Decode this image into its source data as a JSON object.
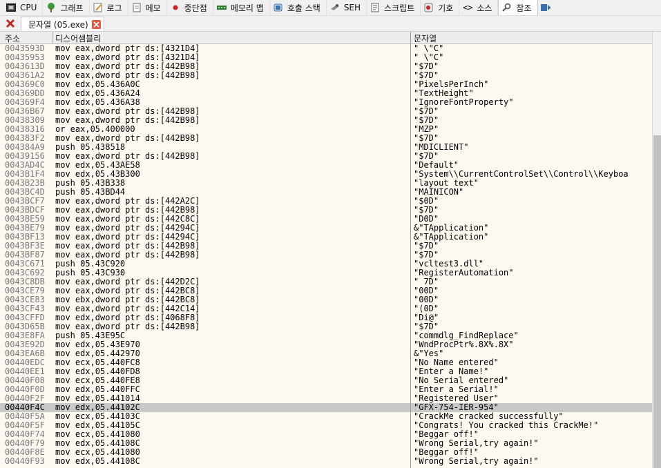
{
  "toolbar": {
    "tabs": [
      {
        "label": "CPU",
        "icon": "cpu-icon"
      },
      {
        "label": "그래프",
        "icon": "graph-icon"
      },
      {
        "label": "로그",
        "icon": "log-icon"
      },
      {
        "label": "메모",
        "icon": "notes-icon"
      },
      {
        "label": "중단점",
        "icon": "breakpoint-icon"
      },
      {
        "label": "메모리 맵",
        "icon": "memory-map-icon"
      },
      {
        "label": "호출 스택",
        "icon": "call-stack-icon"
      },
      {
        "label": "SEH",
        "icon": "seh-icon"
      },
      {
        "label": "스크립트",
        "icon": "script-icon"
      },
      {
        "label": "기호",
        "icon": "symbols-icon"
      },
      {
        "label": "소스",
        "icon": "source-icon"
      },
      {
        "label": "참조",
        "icon": "references-icon"
      }
    ],
    "active": "참조"
  },
  "doc_tab": {
    "label": "문자열 (05.exe)"
  },
  "columns": {
    "address": "주소",
    "disassembly": "디스어셈블리",
    "string": "문자열"
  },
  "selected_index": 40,
  "rows": [
    {
      "addr": "0043593D",
      "dis": "mov eax,dword ptr ds:[4321D4]",
      "str": "\" \\\"C\""
    },
    {
      "addr": "00435953",
      "dis": "mov eax,dword ptr ds:[4321D4]",
      "str": "\" \\\"C\""
    },
    {
      "addr": "0043613D",
      "dis": "mov eax,dword ptr ds:[442B98]",
      "str": "\"$7D\""
    },
    {
      "addr": "004361A2",
      "dis": "mov eax,dword ptr ds:[442B98]",
      "str": "\"$7D\""
    },
    {
      "addr": "004369C0",
      "dis": "mov edx,05.436A0C",
      "str": "\"PixelsPerInch\""
    },
    {
      "addr": "004369DD",
      "dis": "mov edx,05.436A24",
      "str": "\"TextHeight\""
    },
    {
      "addr": "004369F4",
      "dis": "mov edx,05.436A38",
      "str": "\"IgnoreFontProperty\""
    },
    {
      "addr": "00436B67",
      "dis": "mov eax,dword ptr ds:[442B98]",
      "str": "\"$7D\""
    },
    {
      "addr": "00438309",
      "dis": "mov eax,dword ptr ds:[442B98]",
      "str": "\"$7D\""
    },
    {
      "addr": "00438316",
      "dis": "or eax,05.400000",
      "str": "\"MZP\""
    },
    {
      "addr": "004383F2",
      "dis": "mov eax,dword ptr ds:[442B98]",
      "str": "\"$7D\""
    },
    {
      "addr": "004384A9",
      "dis": "push 05.438518",
      "str": "\"MDICLIENT\""
    },
    {
      "addr": "00439156",
      "dis": "mov eax,dword ptr ds:[442B98]",
      "str": "\"$7D\""
    },
    {
      "addr": "0043AD4C",
      "dis": "mov edx,05.43AE58",
      "str": "\"Default\""
    },
    {
      "addr": "0043B1F4",
      "dis": "mov edx,05.43B300",
      "str": "\"System\\\\CurrentControlSet\\\\Control\\\\Keyboa"
    },
    {
      "addr": "0043B23B",
      "dis": "push 05.43B338",
      "str": "\"layout text\""
    },
    {
      "addr": "0043BC4D",
      "dis": "push 05.43BD44",
      "str": "\"MAINICON\""
    },
    {
      "addr": "0043BCF7",
      "dis": "mov eax,dword ptr ds:[442A2C]",
      "str": "\"$0D\""
    },
    {
      "addr": "0043BDCF",
      "dis": "mov eax,dword ptr ds:[442B98]",
      "str": "\"$7D\""
    },
    {
      "addr": "0043BE59",
      "dis": "mov eax,dword ptr ds:[442C8C]",
      "str": "\"D0D\""
    },
    {
      "addr": "0043BE79",
      "dis": "mov eax,dword ptr ds:[44294C]",
      "str": "&\"TApplication\""
    },
    {
      "addr": "0043BF13",
      "dis": "mov eax,dword ptr ds:[44294C]",
      "str": "&\"TApplication\""
    },
    {
      "addr": "0043BF3E",
      "dis": "mov eax,dword ptr ds:[442B98]",
      "str": "\"$7D\""
    },
    {
      "addr": "0043BF87",
      "dis": "mov eax,dword ptr ds:[442B98]",
      "str": "\"$7D\""
    },
    {
      "addr": "0043C671",
      "dis": "push 05.43C920",
      "str": "\"vcltest3.dll\""
    },
    {
      "addr": "0043C692",
      "dis": "push 05.43C930",
      "str": "\"RegisterAutomation\""
    },
    {
      "addr": "0043C8DB",
      "dis": "mov eax,dword ptr ds:[442D2C]",
      "str": "\" 7D\""
    },
    {
      "addr": "0043CE79",
      "dis": "mov eax,dword ptr ds:[442BC8]",
      "str": "\"00D\""
    },
    {
      "addr": "0043CE83",
      "dis": "mov ebx,dword ptr ds:[442BC8]",
      "str": "\"00D\""
    },
    {
      "addr": "0043CF43",
      "dis": "mov eax,dword ptr ds:[442C14]",
      "str": "\"(0D\""
    },
    {
      "addr": "0043CFFD",
      "dis": "mov edx,dword ptr ds:[4068F8]",
      "str": "\"Di@\""
    },
    {
      "addr": "0043D65B",
      "dis": "mov eax,dword ptr ds:[442B98]",
      "str": "\"$7D\""
    },
    {
      "addr": "0043E8FA",
      "dis": "push 05.43E95C",
      "str": "\"commdlg_FindReplace\""
    },
    {
      "addr": "0043E92D",
      "dis": "mov edx,05.43E970",
      "str": "\"WndProcPtr%.8X%.8X\""
    },
    {
      "addr": "0043EA6B",
      "dis": "mov edx,05.442970",
      "str": "&\"Yes\""
    },
    {
      "addr": "00440EDC",
      "dis": "mov ecx,05.440FC8",
      "str": "\"No Name entered\""
    },
    {
      "addr": "00440EE1",
      "dis": "mov edx,05.440FD8",
      "str": "\"Enter a Name!\""
    },
    {
      "addr": "00440F08",
      "dis": "mov ecx,05.440FE8",
      "str": "\"No Serial entered\""
    },
    {
      "addr": "00440F0D",
      "dis": "mov edx,05.440FFC",
      "str": "\"Enter a Serial!\""
    },
    {
      "addr": "00440F2F",
      "dis": "mov edx,05.441014",
      "str": "\"Registered User\""
    },
    {
      "addr": "00440F4C",
      "dis": "mov edx,05.44102C",
      "str": "\"GFX-754-IER-954\""
    },
    {
      "addr": "00440F5A",
      "dis": "mov ecx,05.44103C",
      "str": "\"CrackMe cracked successfully\""
    },
    {
      "addr": "00440F5F",
      "dis": "mov edx,05.44105C",
      "str": "\"Congrats! You cracked this CrackMe!\""
    },
    {
      "addr": "00440F74",
      "dis": "mov ecx,05.441080",
      "str": "\"Beggar off!\""
    },
    {
      "addr": "00440F79",
      "dis": "mov edx,05.44108C",
      "str": "\"Wrong Serial,try again!\""
    },
    {
      "addr": "00440F8E",
      "dis": "mov ecx,05.441080",
      "str": "\"Beggar off!\""
    },
    {
      "addr": "00440F93",
      "dis": "mov edx,05.44108C",
      "str": "\"Wrong Serial,try again!\""
    }
  ]
}
